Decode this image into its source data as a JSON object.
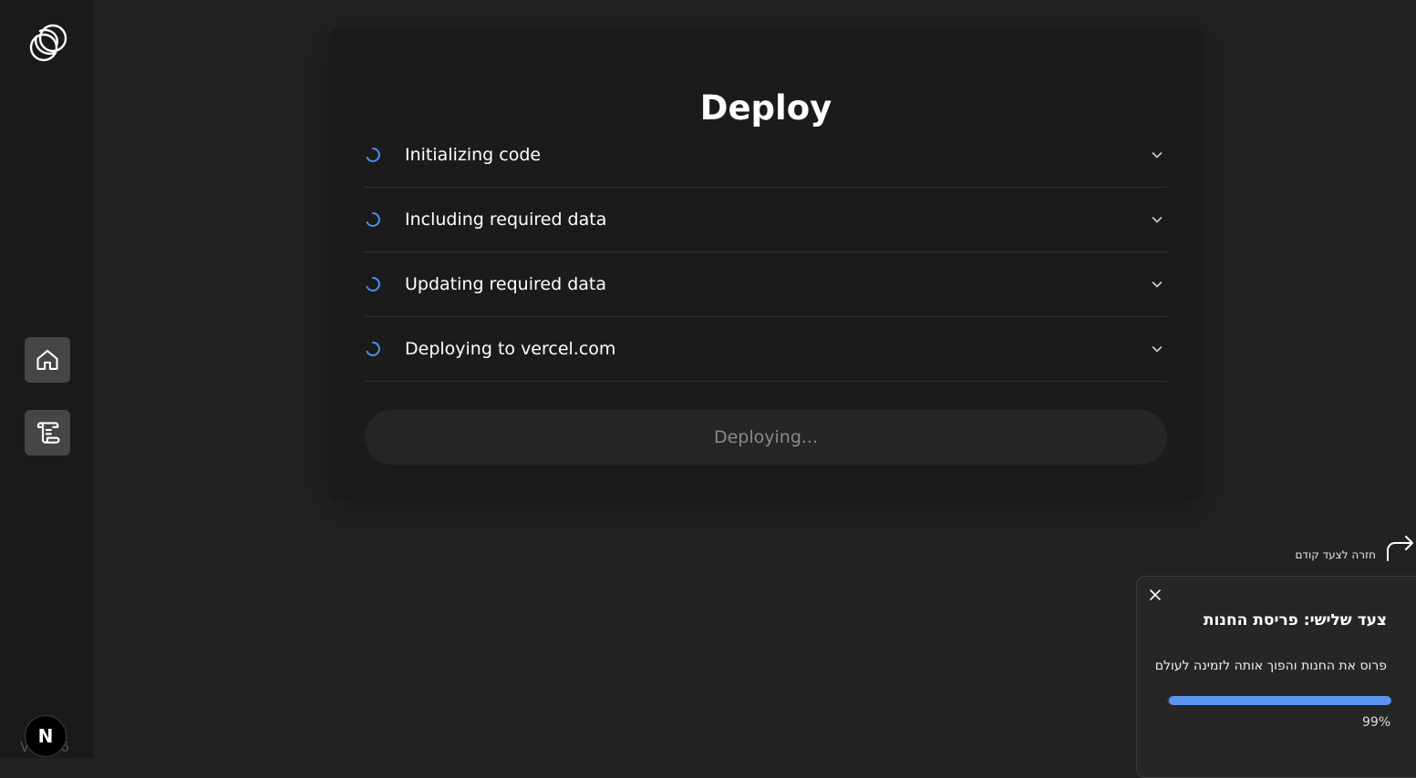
{
  "sidebar": {
    "logo_icon": "infinity-knot-logo-icon",
    "items": [
      {
        "name": "home",
        "icon": "home-icon"
      },
      {
        "name": "scroll",
        "icon": "scroll-icon"
      }
    ],
    "version": "V… 2.6",
    "badge": "N"
  },
  "deploy": {
    "title": "Deploy",
    "steps": [
      {
        "label": "Initializing code",
        "status": "loading"
      },
      {
        "label": "Including required data",
        "status": "loading"
      },
      {
        "label": "Updating required data",
        "status": "loading"
      },
      {
        "label": "Deploying to vercel.com",
        "status": "loading"
      }
    ],
    "button_label": "Deploying..."
  },
  "tour": {
    "back_label": "חזרה לצעד קודם",
    "title": "צעד שלישי: פריסת החנות",
    "description": "פרוס את החנות והפוך אותה לזמינה לעולם",
    "progress": 99,
    "progress_text": "99%"
  },
  "colors": {
    "accent": "#5b95f0",
    "background": "#222222",
    "card": "#1b1b1b",
    "sidebar": "#1a1a1a"
  }
}
